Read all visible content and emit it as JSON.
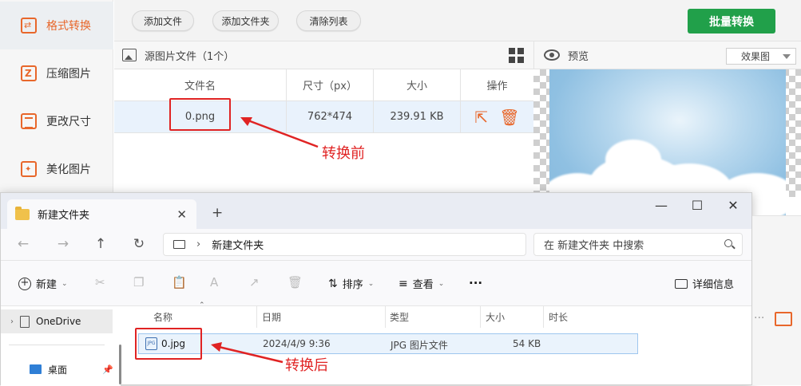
{
  "sidebar": {
    "items": [
      {
        "label": "格式转换",
        "icon": "convert-icon",
        "active": true
      },
      {
        "label": "压缩图片",
        "icon": "compress-icon"
      },
      {
        "label": "更改尺寸",
        "icon": "resize-icon"
      },
      {
        "label": "美化图片",
        "icon": "beautify-icon"
      }
    ]
  },
  "toolbar": {
    "add_file": "添加文件",
    "add_folder": "添加文件夹",
    "clear_list": "清除列表",
    "batch_convert": "批量转换",
    "accent": "#21a04a"
  },
  "source": {
    "title": "源图片文件（1个）",
    "columns": [
      "文件名",
      "尺寸（px）",
      "大小",
      "操作"
    ],
    "rows": [
      {
        "name": "0.png",
        "dimensions": "762*474",
        "size": "239.91 KB"
      }
    ]
  },
  "preview": {
    "title": "预览",
    "mode": "效果图"
  },
  "annotations": {
    "before": "转换前",
    "after": "转换后",
    "color": "#e02323"
  },
  "explorer": {
    "tab_title": "新建文件夹",
    "breadcrumb": "新建文件夹",
    "search_placeholder": "在 新建文件夹 中搜索",
    "commands": {
      "new": "新建",
      "sort": "排序",
      "view": "查看",
      "more": "···",
      "details": "详细信息"
    },
    "nav": {
      "onedrive": "OneDrive",
      "desktop": "桌面"
    },
    "columns": [
      "名称",
      "日期",
      "类型",
      "大小",
      "时长"
    ],
    "rows": [
      {
        "name": "0.jpg",
        "date": "2024/4/9 9:36",
        "type": "JPG 图片文件",
        "size": "54 KB",
        "duration": ""
      }
    ]
  }
}
